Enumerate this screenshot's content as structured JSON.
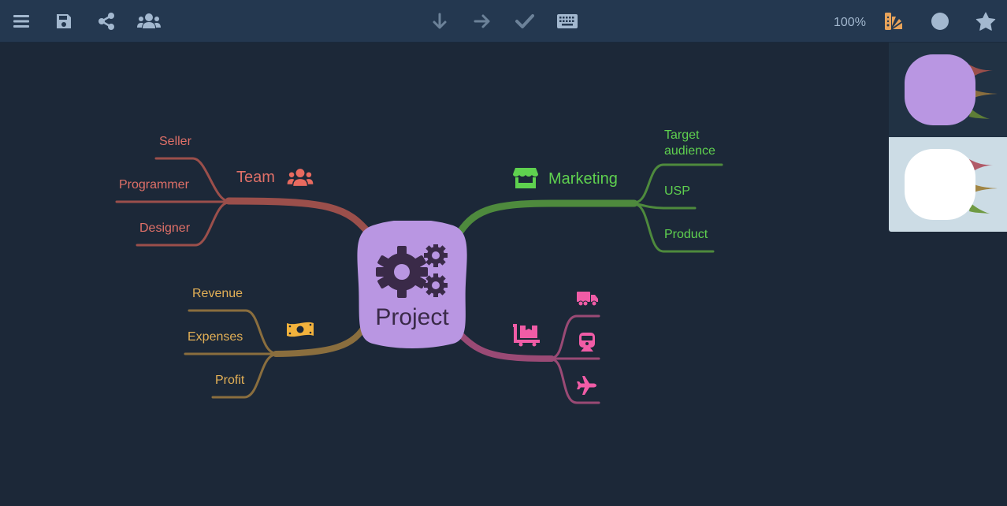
{
  "toolbar": {
    "left_icons": [
      "menu-icon",
      "save-icon",
      "share-icon",
      "users-icon"
    ],
    "center_icons": [
      "arrow-down-icon",
      "arrow-right-icon",
      "check-icon",
      "keyboard-icon"
    ],
    "zoom_level": "100%",
    "right_icons": [
      "palette-icon",
      "circle-icon",
      "star-icon"
    ]
  },
  "colors": {
    "background": "#1c2838",
    "toolbar": "#243850",
    "root": "#b996e2",
    "team": "#e07068",
    "marketing": "#5fd14f",
    "finance": "#e3b056",
    "logistics": "#f05ca6"
  },
  "mindmap": {
    "root": {
      "label": "Project",
      "icon": "gears-icon"
    },
    "branches": [
      {
        "label": "Team",
        "icon": "users-icon",
        "children": [
          "Seller",
          "Programmer",
          "Designer"
        ]
      },
      {
        "label": "Marketing",
        "icon": "store-icon",
        "children": [
          "Target audience",
          "USP",
          "Product"
        ]
      },
      {
        "label": "",
        "icon": "money-bill-icon",
        "children": [
          "Revenue",
          "Expenses",
          "Profit"
        ]
      },
      {
        "label": "",
        "icon": "dolly-icon",
        "children": [
          {
            "label": "",
            "icon": "truck-icon"
          },
          {
            "label": "",
            "icon": "train-icon"
          },
          {
            "label": "",
            "icon": "plane-icon"
          }
        ]
      }
    ]
  },
  "themes": [
    {
      "name": "dark-theme",
      "selected": true
    },
    {
      "name": "light-theme",
      "selected": false
    }
  ],
  "text": {
    "team": "Team",
    "seller": "Seller",
    "programmer": "Programmer",
    "designer": "Designer",
    "marketing": "Marketing",
    "target1": "Target",
    "target2": "audience",
    "usp": "USP",
    "product": "Product",
    "revenue": "Revenue",
    "expenses": "Expenses",
    "profit": "Profit",
    "project": "Project"
  }
}
